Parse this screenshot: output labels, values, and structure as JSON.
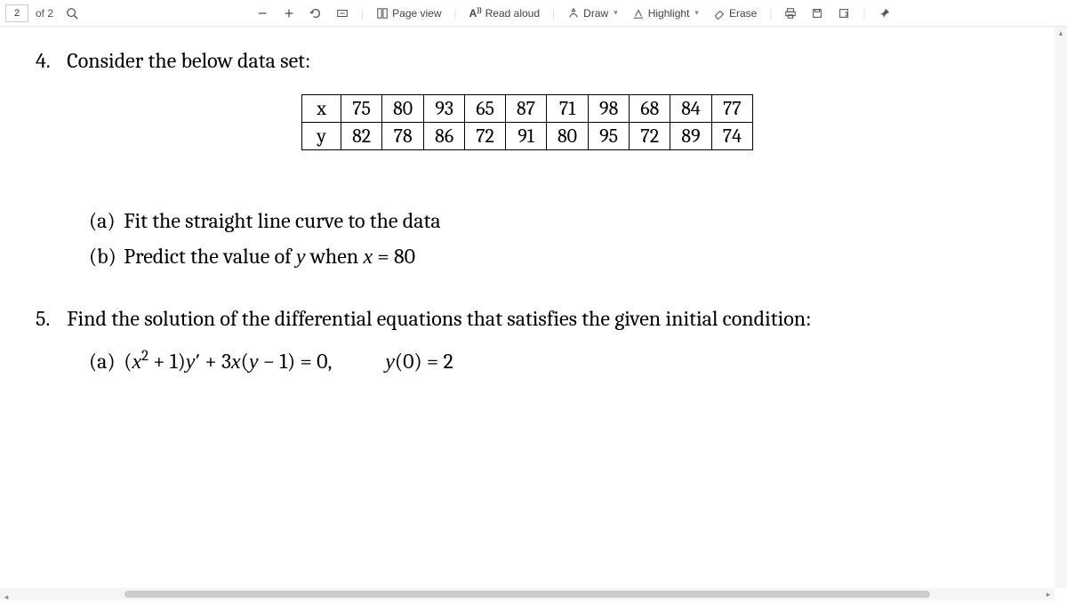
{
  "toolbar": {
    "page_current": "2",
    "page_of": "of 2",
    "page_view": "Page view",
    "read_aloud": "Read aloud",
    "draw": "Draw",
    "highlight": "Highlight",
    "erase": "Erase"
  },
  "q4": {
    "num": "4.",
    "text": "Consider the below data set:",
    "table": {
      "row_labels": [
        "x",
        "y"
      ],
      "x": [
        "75",
        "80",
        "93",
        "65",
        "87",
        "71",
        "98",
        "68",
        "84",
        "77"
      ],
      "y": [
        "82",
        "78",
        "86",
        "72",
        "91",
        "80",
        "95",
        "72",
        "89",
        "74"
      ]
    },
    "a_label": "(a)",
    "a_text": "Fit the straight line curve to the data",
    "b_label": "(b)",
    "b_text_pre": "Predict the value of ",
    "b_text_mid": " when ",
    "b_var_y": "y",
    "b_var_x": "x",
    "b_eq": " = 80"
  },
  "q5": {
    "num": "5.",
    "text": "Find the solution of the differential equations that satisfies the given initial condition:",
    "a_label": "(a)",
    "eq1_a": "(",
    "eq1_b": "x",
    "eq1_c": " + 1)",
    "eq1_d": "y",
    "eq1_e": "′ + 3",
    "eq1_f": "x",
    "eq1_g": "(",
    "eq1_h": "y",
    "eq1_i": " − 1) = 0,",
    "eq2_a": "y",
    "eq2_b": "(0) = 2"
  }
}
